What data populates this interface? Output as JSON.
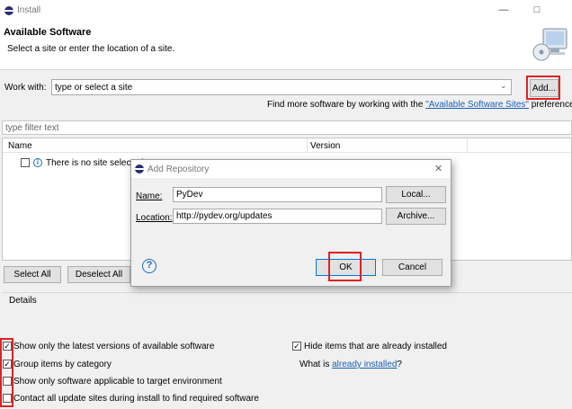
{
  "window": {
    "title": "Install",
    "minimize_icon": "minimize-icon",
    "maximize_icon": "maximize-icon"
  },
  "header": {
    "title": "Available Software",
    "subtitle": "Select a site or enter the location of a site."
  },
  "work_with": {
    "label": "Work with:",
    "value": "type or select a site",
    "add_button": "Add...",
    "find_more_prefix": "Find more software by working with the ",
    "find_more_link": "\"Available Software Sites\"",
    "find_more_suffix": " preferences"
  },
  "filter": {
    "placeholder": "type filter text"
  },
  "table": {
    "columns": [
      "Name",
      "Version"
    ],
    "rows": [
      {
        "text": "There is no site selected."
      }
    ]
  },
  "buttons": {
    "select_all": "Select All",
    "deselect_all": "Deselect All"
  },
  "details": {
    "label": "Details"
  },
  "options": {
    "latest_versions": {
      "label": "Show only the latest versions of available software",
      "checked": true
    },
    "group_items": {
      "label": "Group items by category",
      "checked": true
    },
    "target_env": {
      "label": "Show only software applicable to target environment",
      "checked": false
    },
    "contact_all": {
      "label": "Contact all update sites during install to find required software",
      "checked": false
    },
    "hide_installed": {
      "label": "Hide items that are already installed",
      "checked": true
    },
    "what_is_prefix": "What is ",
    "what_is_link": "already installed",
    "what_is_suffix": "?"
  },
  "dialog": {
    "title": "Add Repository",
    "name_label": "Name:",
    "name_value": "PyDev",
    "location_label": "Location:",
    "location_value": "http://pydev.org/updates",
    "local_button": "Local...",
    "archive_button": "Archive...",
    "ok_button": "OK",
    "cancel_button": "Cancel",
    "close_icon": "close-icon",
    "help_icon": "help-icon"
  },
  "colors": {
    "highlight_red": "#e02020",
    "link_blue": "#1a5fb4"
  }
}
